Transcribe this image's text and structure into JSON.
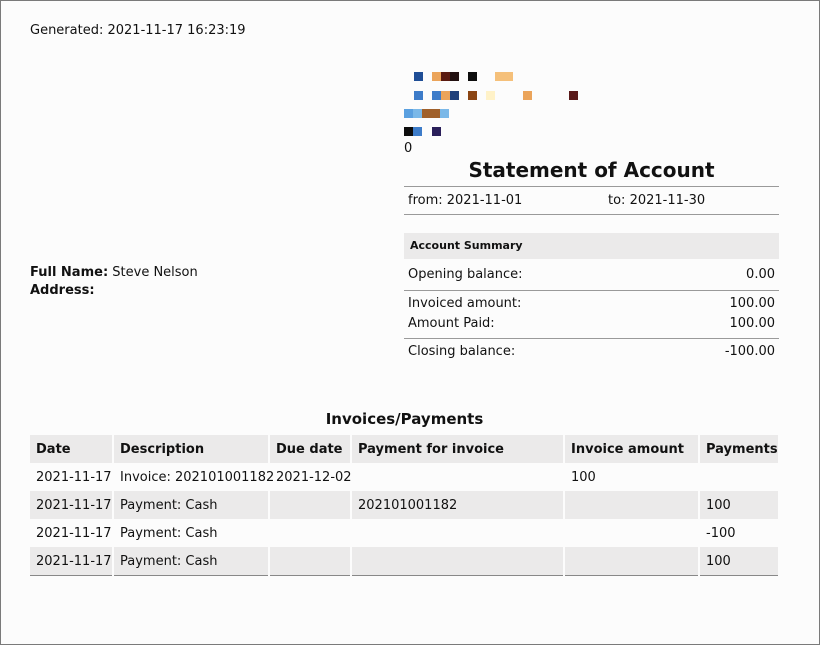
{
  "generated": "Generated: 2021-11-17 16:23:19",
  "logo": {
    "caption": "0"
  },
  "statement": {
    "title": "Statement of Account",
    "from": "from: 2021-11-01",
    "to": "to: 2021-11-30"
  },
  "summary": {
    "heading": "Account Summary",
    "opening_label": "Opening balance:",
    "opening_value": "0.00",
    "invoiced_label": "Invoiced amount:",
    "invoiced_value": "100.00",
    "paid_label": "Amount Paid:",
    "paid_value": "100.00",
    "closing_label": "Closing balance:",
    "closing_value": "-100.00"
  },
  "customer": {
    "name_label": "Full Name:",
    "name_value": "Steve Nelson",
    "address_label": "Address:",
    "address_value": ""
  },
  "transactions": {
    "title": "Invoices/Payments",
    "headers": [
      "Date",
      "Description",
      "Due date",
      "Payment for invoice",
      "Invoice amount",
      "Payments"
    ],
    "rows": [
      [
        "2021-11-17",
        "Invoice: 202101001182",
        "2021-12-02",
        "",
        "100",
        ""
      ],
      [
        "2021-11-17",
        "Payment: Cash",
        "",
        "202101001182",
        "",
        "100"
      ],
      [
        "2021-11-17",
        "Payment: Cash",
        "",
        "",
        "",
        "-100"
      ],
      [
        "2021-11-17",
        "Payment: Cash",
        "",
        "",
        "",
        "100"
      ]
    ]
  }
}
